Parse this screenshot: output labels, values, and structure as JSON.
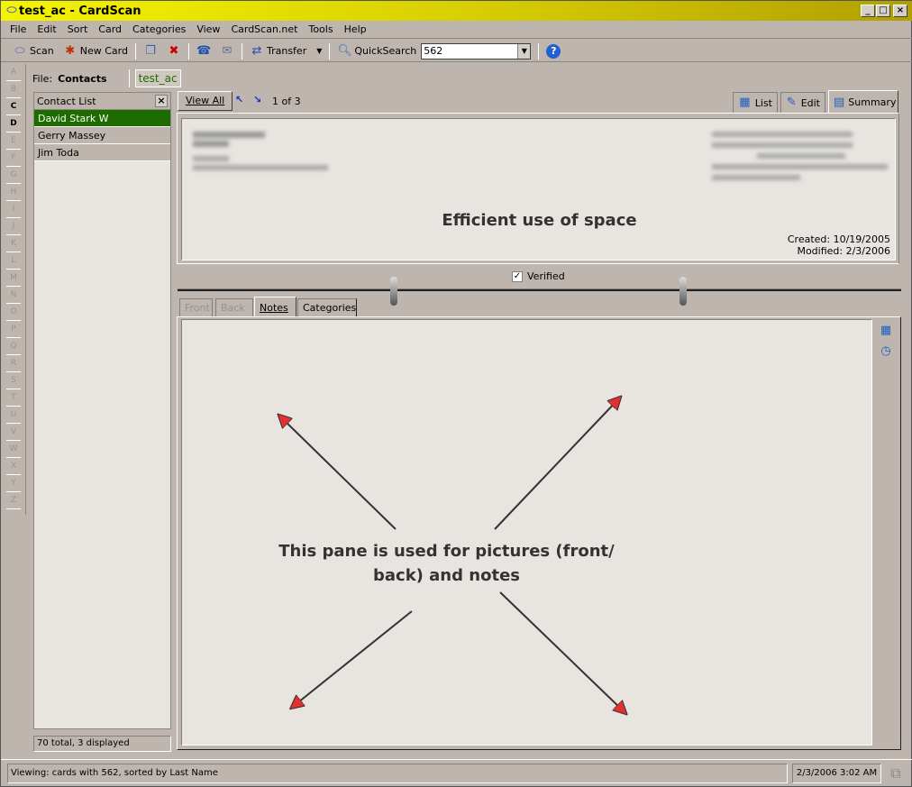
{
  "window": {
    "title": "test_ac - CardScan"
  },
  "menu": [
    "File",
    "Edit",
    "Sort",
    "Card",
    "Categories",
    "View",
    "CardScan.net",
    "Tools",
    "Help"
  ],
  "toolbar": {
    "scan": "Scan",
    "new_card": "New Card",
    "transfer": "Transfer",
    "quicksearch": "QuickSearch",
    "search_value": "562"
  },
  "alphabet": [
    "A",
    "B",
    "C",
    "D",
    "E",
    "F",
    "G",
    "H",
    "I",
    "J",
    "K",
    "L",
    "M",
    "N",
    "O",
    "P",
    "Q",
    "R",
    "S",
    "T",
    "U",
    "V",
    "W",
    "X",
    "Y",
    "Z"
  ],
  "file": {
    "label": "File:",
    "name": "Contacts",
    "tab": "test_ac"
  },
  "contact_list": {
    "title": "Contact List",
    "items": [
      "David Stark W",
      "Gerry Massey",
      "Jim Toda"
    ],
    "selected": 0,
    "footer": "70 total, 3 displayed"
  },
  "nav": {
    "view_all": "View All",
    "position": "1 of 3"
  },
  "view_tabs": [
    "List",
    "Edit",
    "Summary"
  ],
  "card": {
    "annotation": "Efficient use of space",
    "created": "Created: 10/19/2005",
    "modified": "Modified: 2/3/2006",
    "verified_label": "Verified",
    "verified": true
  },
  "bottom_tabs": [
    "Front",
    "Back",
    "Notes",
    "Categories"
  ],
  "notes": {
    "annotation_line1": "This pane is used for pictures (front/",
    "annotation_line2": "back) and notes"
  },
  "status": {
    "text": "Viewing: cards with 562, sorted by Last Name",
    "datetime": "2/3/2006 3:02 AM"
  },
  "colors": {
    "selected_row": "#1e6b00",
    "arrow": "#e03030",
    "title_bar": "#e0e000"
  }
}
